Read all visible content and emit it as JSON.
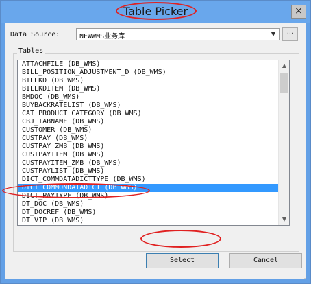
{
  "window": {
    "title": "Table Picker",
    "close_label": "×"
  },
  "data_source": {
    "label": "Data Source:",
    "value": "NEWWMS业务库",
    "browse_label": "..."
  },
  "tables": {
    "group_label": "Tables",
    "items": [
      "ATTACHFILE (DB_WMS)",
      "BILL_POSITION_ADJUSTMENT_D (DB_WMS)",
      "BILLKD (DB_WMS)",
      "BILLKDITEM (DB_WMS)",
      "BMDOC (DB_WMS)",
      "BUYBACKRATELIST (DB_WMS)",
      "CAT_PRODUCT_CATEGORY (DB_WMS)",
      "CBJ_TABNAME (DB_WMS)",
      "CUSTOMER (DB_WMS)",
      "CUSTPAY (DB_WMS)",
      "CUSTPAY_ZMB (DB_WMS)",
      "CUSTPAYITEM (DB_WMS)",
      "CUSTPAYITEM_ZMB (DB_WMS)",
      "CUSTPAYLIST (DB_WMS)",
      "DICT_COMMDATADICTTYPE (DB_WMS)",
      "DICT_COMMONDATADICT (DB_WMS)",
      "DICT_PAYTYPE (DB_WMS)",
      "DT_DOC (DB_WMS)",
      "DT_DOCREF (DB_WMS)",
      "DT_VIP (DB_WMS)"
    ],
    "selected_index": 15
  },
  "buttons": {
    "select": "Select",
    "cancel": "Cancel"
  },
  "colors": {
    "annotation": "#e02020",
    "selection": "#3399ff",
    "titlebar": "#69a7ec"
  }
}
